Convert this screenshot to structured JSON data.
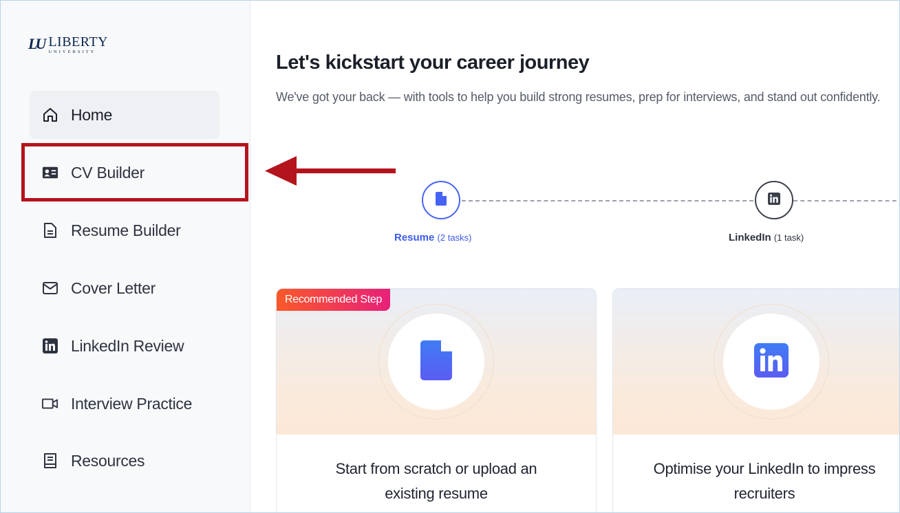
{
  "brand": {
    "logo_mark": "LU",
    "logo_word": "LIBERTY",
    "logo_sub": "UNIVERSITY"
  },
  "sidebar": {
    "items": [
      {
        "label": "Home",
        "icon": "home-icon",
        "active": true
      },
      {
        "label": "CV Builder",
        "icon": "id-card-icon",
        "active": false
      },
      {
        "label": "Resume Builder",
        "icon": "document-icon",
        "active": false
      },
      {
        "label": "Cover Letter",
        "icon": "envelope-icon",
        "active": false
      },
      {
        "label": "LinkedIn Review",
        "icon": "linkedin-icon",
        "active": false
      },
      {
        "label": "Interview Practice",
        "icon": "video-camera-icon",
        "active": false
      },
      {
        "label": "Resources",
        "icon": "book-icon",
        "active": false
      }
    ]
  },
  "main": {
    "title": "Let's kickstart your career journey",
    "subtitle": "We've got your back — with tools to help you build strong resumes, prep for interviews, and stand out confidently.",
    "steps": [
      {
        "name": "Resume",
        "count": "(2 tasks)",
        "icon": "document-icon",
        "status": "active"
      },
      {
        "name": "LinkedIn",
        "count": "(1 task)",
        "icon": "linkedin-icon",
        "status": "inactive"
      }
    ],
    "cards": [
      {
        "badge": "Recommended Step",
        "icon": "document-icon",
        "text": "Start from scratch or upload an existing resume"
      },
      {
        "icon": "linkedin-icon",
        "text": "Optimise your LinkedIn to impress recruiters"
      }
    ]
  },
  "colors": {
    "accent": "#4563f5",
    "highlight": "#b4141c",
    "badge_start": "#f9592a",
    "badge_end": "#e8207a"
  }
}
